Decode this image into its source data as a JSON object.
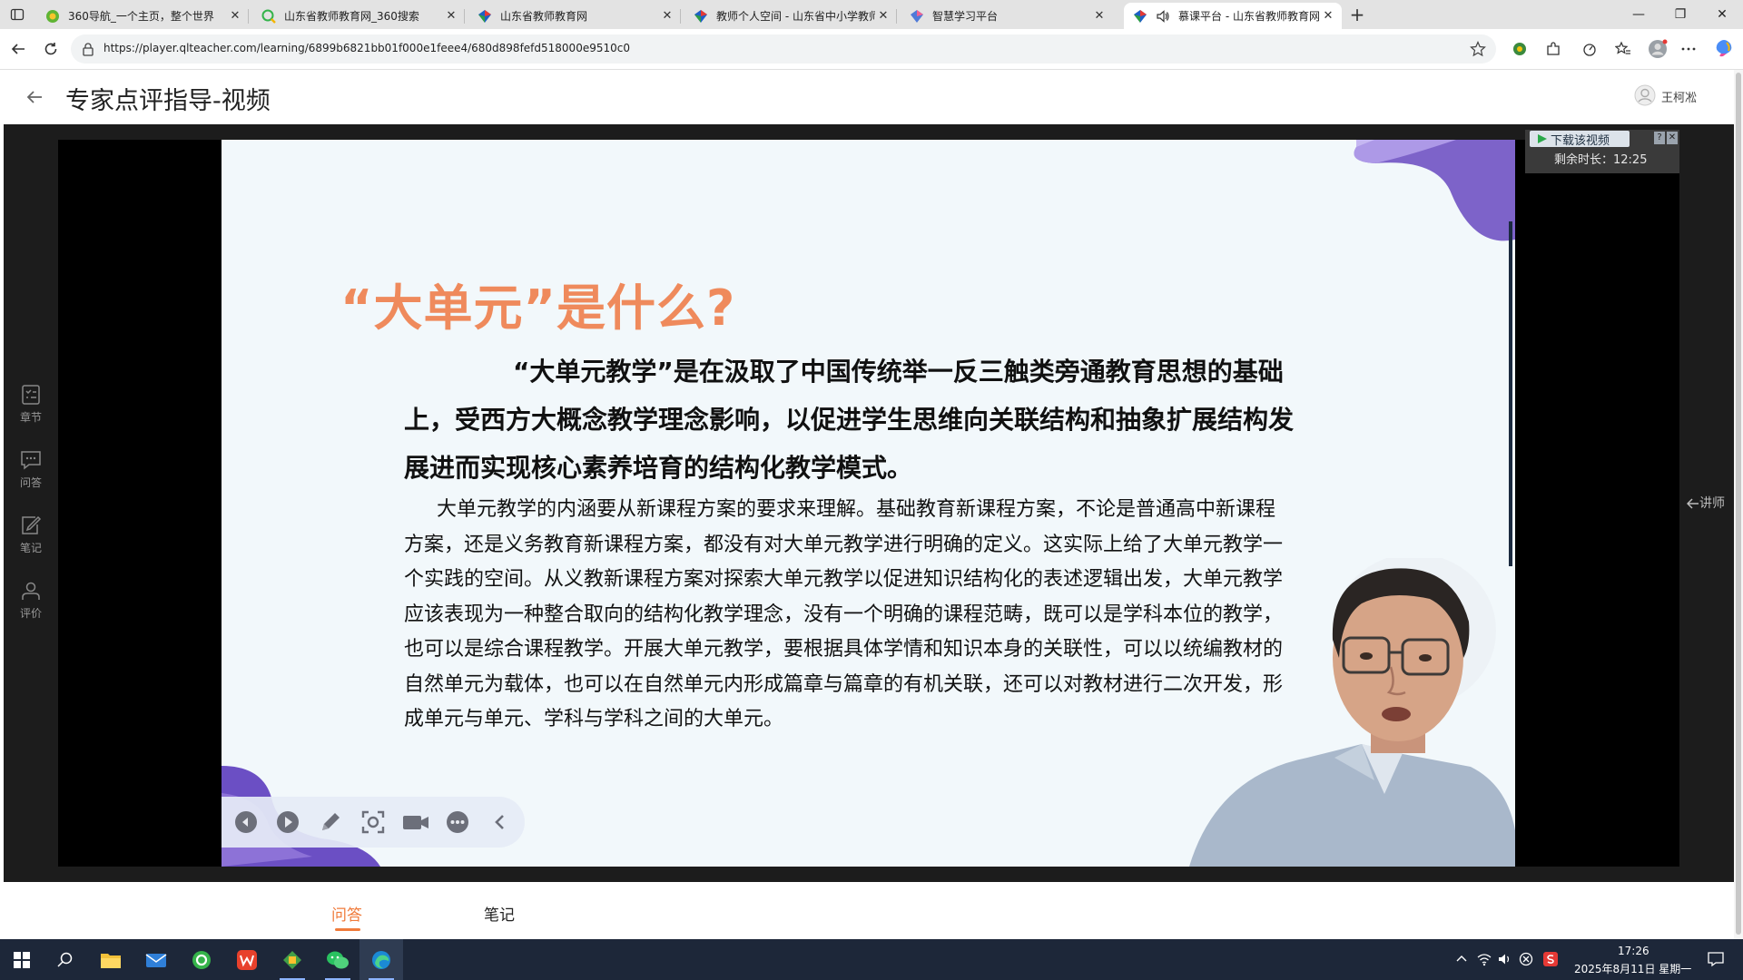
{
  "browser": {
    "tabs": [
      {
        "title": "360导航_一个主页，整个世界",
        "active": false
      },
      {
        "title": "山东省教师教育网_360搜索",
        "active": false
      },
      {
        "title": "山东省教师教育网",
        "active": false
      },
      {
        "title": "教师个人空间 - 山东省中小学教师",
        "active": false
      },
      {
        "title": "智慧学习平台",
        "active": false
      },
      {
        "title": "慕课平台 - 山东省教师教育网",
        "active": true
      }
    ],
    "new_tab": "+",
    "close_glyph": "✕",
    "url": "https://player.qlteacher.com/learning/6899b6821bb01f000e1feee4/680d898fefd518000e9510c0",
    "window": {
      "minimize": "—",
      "restore": "❐",
      "close": "✕"
    }
  },
  "page": {
    "back_glyph": "←",
    "title": "专家点评指导-视频",
    "user_name": "王柯凇"
  },
  "slide": {
    "heading": "“大单元”是什么?",
    "lead": "“大单元教学”是在汲取了中国传统举一反三触类旁通教育思想的基础上，受西方大概念教学理念影响，以促进学生思维向关联结构和抽象扩展结构发展进而实现核心素养培育的结构化教学模式。",
    "body": "大单元教学的内涵要从新课程方案的要求来理解。基础教育新课程方案，不论是普通高中新课程方案，还是义务教育新课程方案，都没有对大单元教学进行明确的定义。这实际上给了大单元教学一个实践的空间。从义教新课程方案对探索大单元教学以促进知识结构化的表述逻辑出发，大单元教学应该表现为一种整合取向的结构化教学理念，没有一个明确的课程范畴，既可以是学科本位的教学，也可以是综合课程教学。开展大单元教学，要根据具体学情和知识本身的关联性，可以以统编教材的自然单元为载体，也可以在自然单元内形成篇章与篇章的有机关联，还可以对教材进行二次开发，形成单元与单元、学科与学科之间的大单元。"
  },
  "player": {
    "download_label": "下载该视频",
    "download_help": "?",
    "download_close": "✕",
    "remaining_label": "剩余时长：12:25",
    "lecturer_toggle": "讲师"
  },
  "left_rail": {
    "items": [
      {
        "label": "章节",
        "icon": "chapter-icon"
      },
      {
        "label": "问答",
        "icon": "chat-icon"
      },
      {
        "label": "笔记",
        "icon": "note-icon"
      },
      {
        "label": "评价",
        "icon": "user-icon"
      }
    ]
  },
  "bottom_tabs": {
    "qa": "问答",
    "notes": "笔记",
    "active": "qa",
    "accent": "#f07b3b"
  },
  "taskbar": {
    "time": "17:26",
    "date": "2025年8月11日 星期一"
  }
}
